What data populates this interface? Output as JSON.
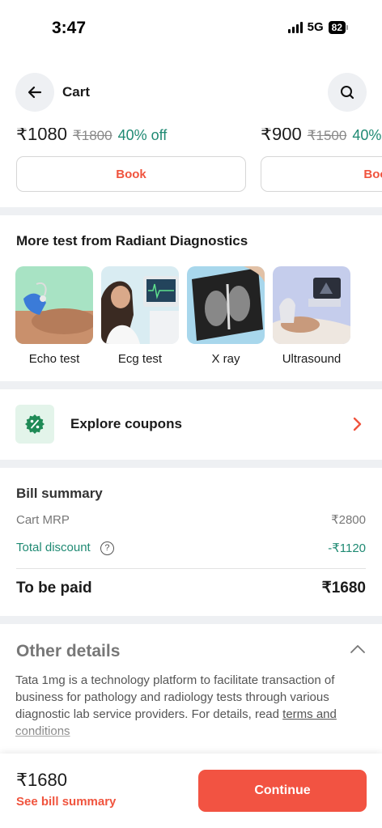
{
  "status_bar": {
    "time": "3:47",
    "network": "5G",
    "battery": "82"
  },
  "header": {
    "title": "Cart",
    "back_icon": "arrow-left-icon",
    "search_icon": "search-icon"
  },
  "packages": [
    {
      "price": "₹1080",
      "mrp": "₹1800",
      "discount": "40% off",
      "button": "Book"
    },
    {
      "price": "₹900",
      "mrp": "₹1500",
      "discount": "40%",
      "button": "Boo"
    }
  ],
  "more_tests": {
    "title": "More test from Radiant Diagnostics",
    "items": [
      {
        "label": "Echo test"
      },
      {
        "label": "Ecg test"
      },
      {
        "label": "X ray"
      },
      {
        "label": "Ultrasound"
      }
    ]
  },
  "coupons": {
    "label": "Explore coupons",
    "icon": "percent-badge-icon",
    "accent": "#f0543e"
  },
  "bill": {
    "title": "Bill summary",
    "cart_mrp_label": "Cart MRP",
    "cart_mrp_value": "₹2800",
    "discount_label": "Total discount",
    "discount_value": "-₹1120",
    "to_pay_label": "To be paid",
    "to_pay_value": "₹1680"
  },
  "other_details": {
    "title": "Other details",
    "text": "Tata 1mg is a technology platform to facilitate transaction of business for pathology and radiology tests through various diagnostic lab service providers. For details, read ",
    "link": "terms and conditions"
  },
  "footer": {
    "total": "₹1680",
    "summary_link": "See bill summary",
    "button": "Continue"
  },
  "colors": {
    "accent": "#f25342",
    "discount_green": "#1f8a73"
  }
}
